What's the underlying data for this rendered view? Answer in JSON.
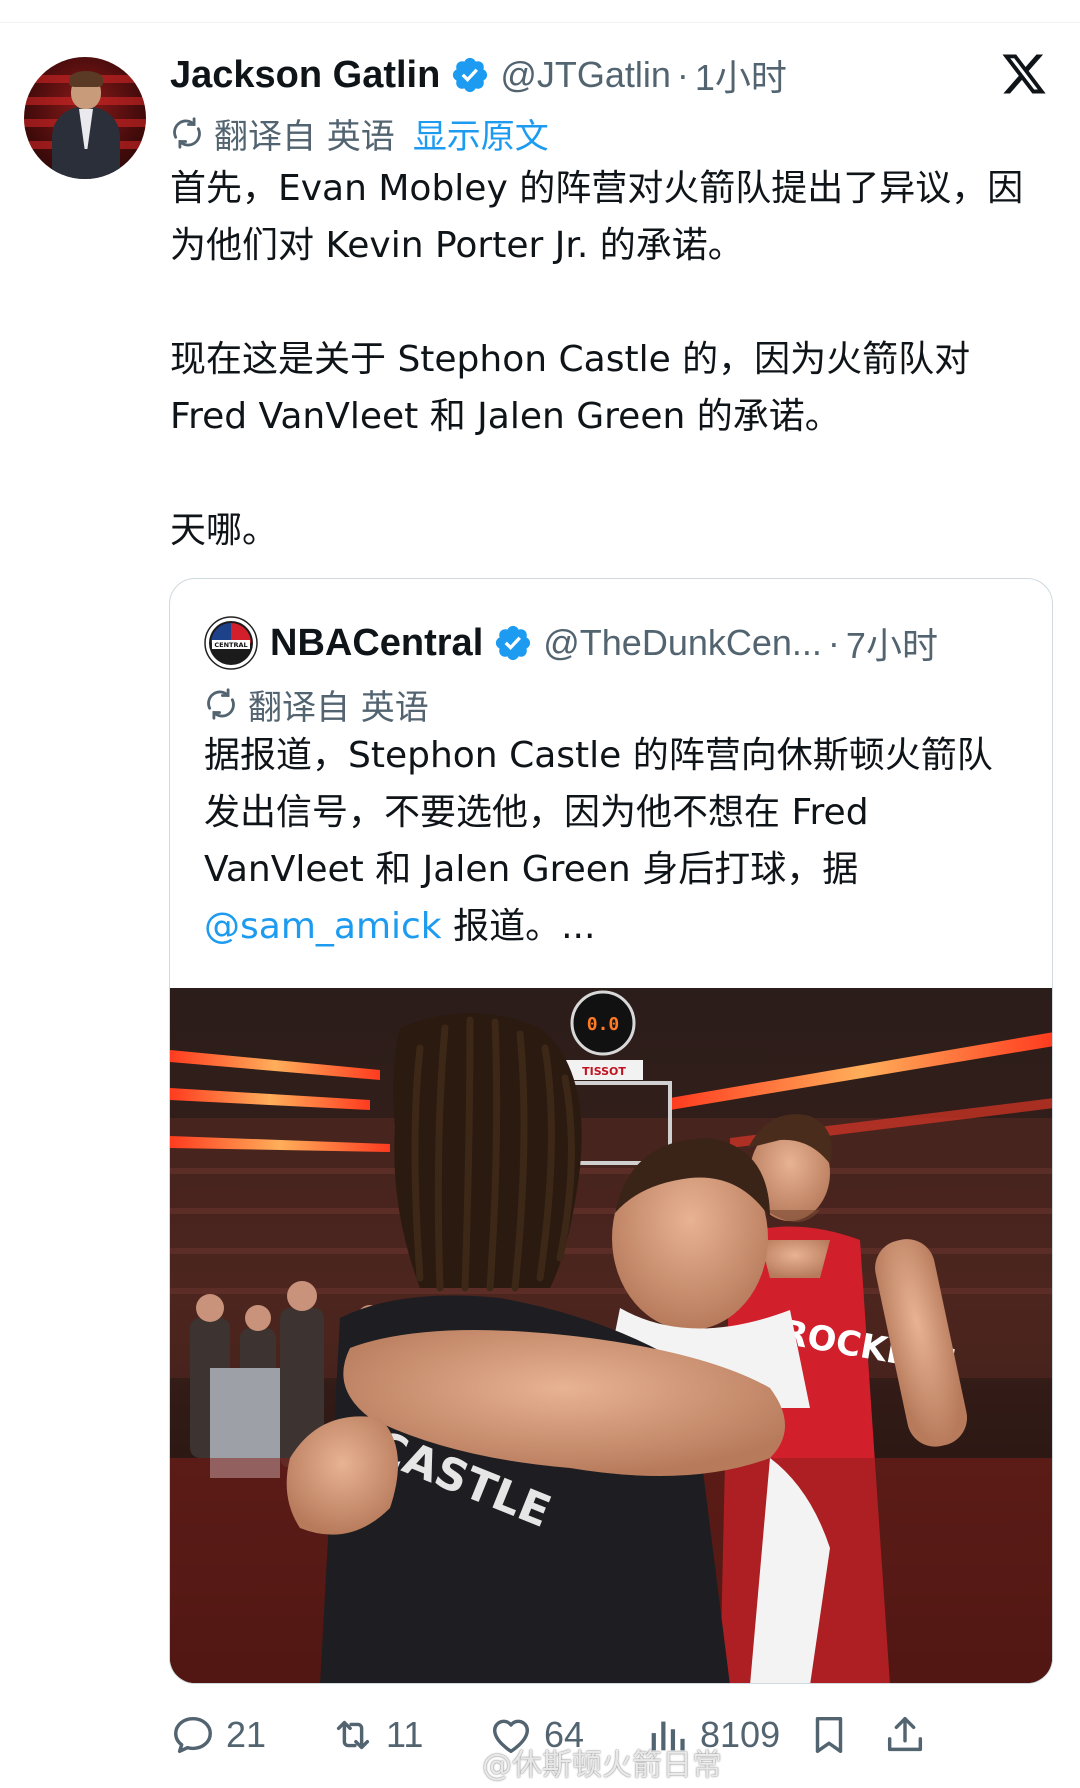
{
  "author": {
    "display_name": "Jackson Gatlin",
    "handle": "@JTGatlin",
    "separator": "·",
    "time": "1小时",
    "verified": true
  },
  "translation": {
    "label": "翻译自 英语",
    "show_original": "显示原文"
  },
  "tweet": {
    "paragraphs": [
      "首先，Evan Mobley 的阵营对火箭队提出了异议，因为他们对 Kevin Porter Jr. 的承诺。",
      "现在这是关于 Stephon Castle 的，因为火箭队对 Fred VanVleet 和 Jalen Green 的承诺。",
      "天哪。"
    ]
  },
  "quoted": {
    "display_name": "NBACentral",
    "handle": "@TheDunkCen...",
    "separator": "·",
    "time": "7小时",
    "translation_label": "翻译自 英语",
    "text_before_mention": "据报道，Stephon Castle 的阵营向休斯顿火箭队发出信号，不要选他，因为他不想在 Fred VanVleet 和 Jalen Green 身后打球，据 ",
    "mention": "@sam_amick",
    "text_after_mention": " 报道。...",
    "avatar_badge_text": "CENTRAL",
    "photo": {
      "scoreboard": "0.0",
      "sponsor": "TISSOT",
      "jersey_left": "CASTLE",
      "jersey_right": "ROCKETS"
    }
  },
  "actions": {
    "reply_count": "21",
    "retweet_count": "11",
    "like_count": "64",
    "view_count": "8109"
  },
  "watermark": "@休斯顿火箭日常",
  "colors": {
    "accent": "#1d9bf0",
    "secondary_text": "#536471",
    "primary_text": "#0f1419",
    "border": "#cfd9de"
  }
}
